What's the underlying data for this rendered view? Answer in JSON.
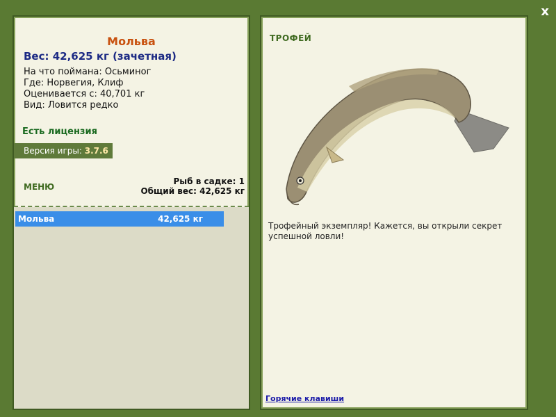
{
  "window": {
    "close_label": "x"
  },
  "left": {
    "title": "Мольва",
    "weight": "Вес: 42,625 кг (зачетная)",
    "info": [
      "На что поймана: Осьминог",
      "Где: Норвегия, Клиф",
      "Оценивается с: 40,701 кг",
      "Вид: Ловится редко"
    ],
    "license": "Есть лицензия",
    "version_label": "Версия игры:",
    "version_value": "3.7.6",
    "menu": "МЕНЮ",
    "stats": {
      "fish_count": "Рыб в садке: 1",
      "total_weight": "Общий вес: 42,625 кг"
    },
    "fish_list": [
      {
        "name": "Мольва",
        "weight": "42,625 кг"
      }
    ]
  },
  "right": {
    "heading": "ТРОФЕЙ",
    "description": "Трофейный экземпляр! Кажется, вы открыли секрет успешной ловли!",
    "hotkeys": "Горячие клавиши"
  }
}
